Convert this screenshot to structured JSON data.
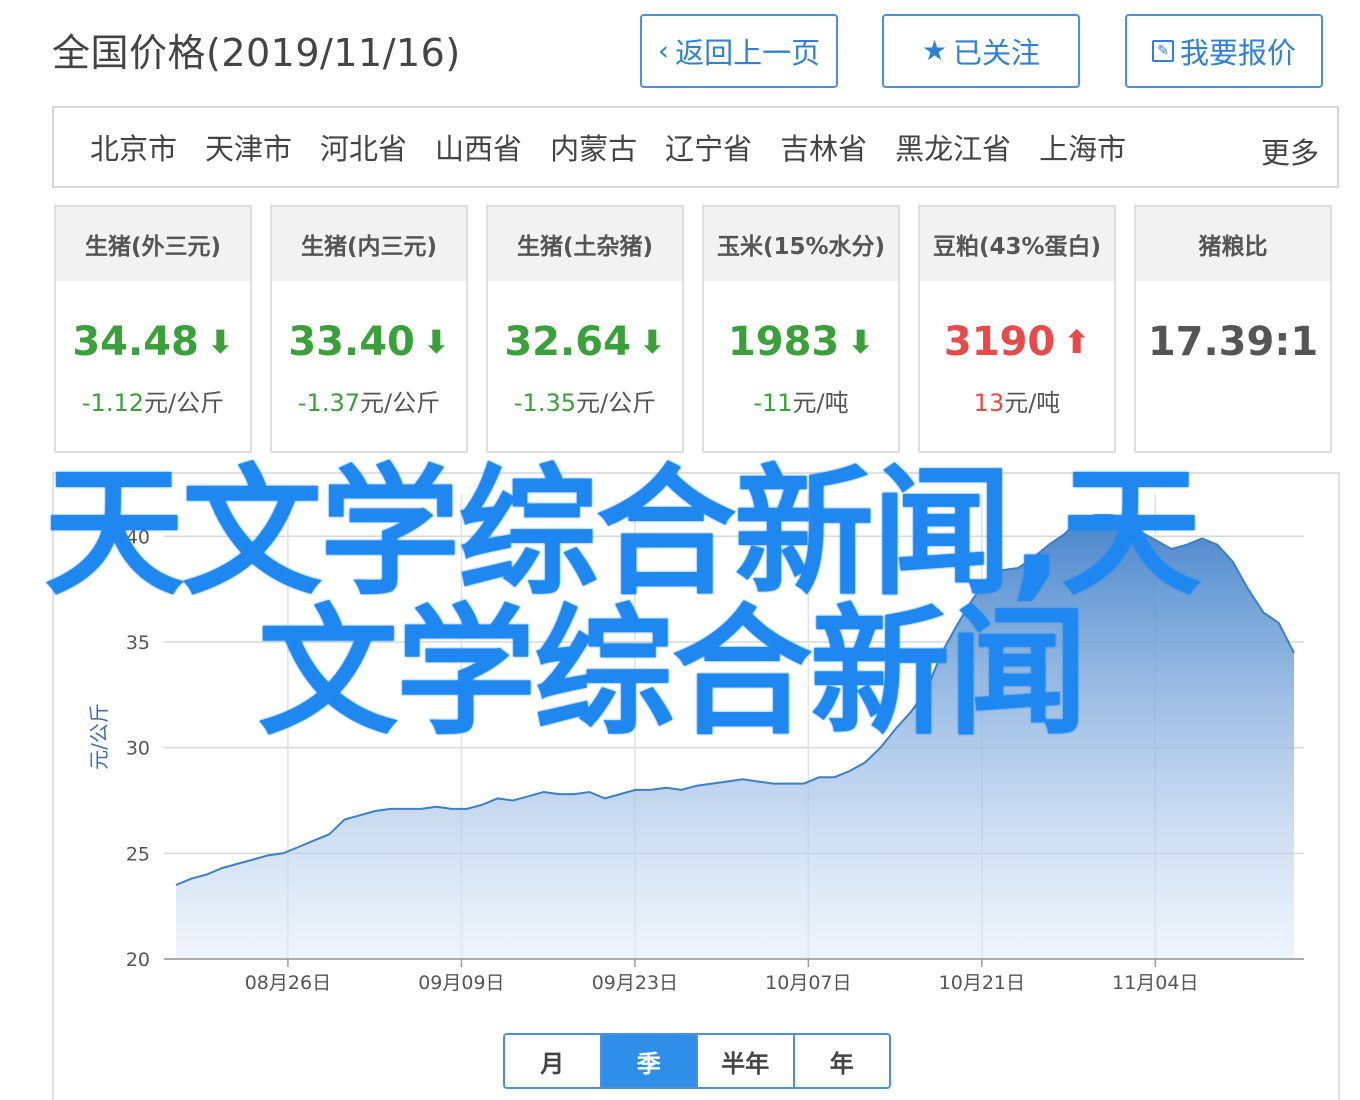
{
  "header": {
    "title": "全国价格(2019/11/16)",
    "back_label": "返回上一页",
    "follow_label": "已关注",
    "report_label": "我要报价"
  },
  "regions": {
    "items": [
      "北京市",
      "天津市",
      "河北省",
      "山西省",
      "内蒙古",
      "辽宁省",
      "吉林省",
      "黑龙江省",
      "上海市"
    ],
    "more_label": "更多"
  },
  "cards": [
    {
      "name": "生猪(外三元)",
      "price": "34.48",
      "trend": "down",
      "change": "-1.12",
      "unit": "元/公斤"
    },
    {
      "name": "生猪(内三元)",
      "price": "33.40",
      "trend": "down",
      "change": "-1.37",
      "unit": "元/公斤"
    },
    {
      "name": "生猪(土杂猪)",
      "price": "32.64",
      "trend": "down",
      "change": "-1.35",
      "unit": "元/公斤"
    },
    {
      "name": "玉米(15%水分)",
      "price": "1983",
      "trend": "down",
      "change": "-11",
      "unit": "元/吨"
    },
    {
      "name": "豆粕(43%蛋白)",
      "price": "3190",
      "trend": "up",
      "change": "13",
      "unit": "元/吨"
    },
    {
      "name": "猪粮比",
      "price": "17.39:1",
      "trend": "none",
      "change": "",
      "unit": ""
    }
  ],
  "colors": {
    "accent": "#2f8fe8",
    "down": "#3aa13a",
    "up": "#e84a4a",
    "line": "#3d7ec9",
    "overlay_text": "#1e88f0"
  },
  "icons": {
    "back": "chevron-left-icon",
    "follow": "star-icon",
    "report": "edit-icon",
    "down": "arrow-down-icon",
    "up": "arrow-up-icon"
  },
  "overlay": {
    "line1": "天文学综合新闻,天",
    "line2": "文学综合新闻"
  },
  "chart_data": {
    "type": "area",
    "ylabel": "元/公斤",
    "ylim": [
      20,
      42
    ],
    "yticks": [
      20,
      25,
      30,
      35,
      40
    ],
    "xtick_labels": [
      "08月26日",
      "09月09日",
      "09月23日",
      "10月07日",
      "10月21日",
      "11月04日"
    ],
    "x_start": "2019-08-16",
    "x_end": "2019-11-16",
    "grid": true,
    "series": [
      {
        "values": [
          23.5,
          23.8,
          24.0,
          24.3,
          24.5,
          24.7,
          24.9,
          25.0,
          25.3,
          25.6,
          25.9,
          26.6,
          26.8,
          27.0,
          27.1,
          27.1,
          27.1,
          27.2,
          27.1,
          27.1,
          27.3,
          27.6,
          27.5,
          27.7,
          27.9,
          27.8,
          27.8,
          27.9,
          27.6,
          27.8,
          28.0,
          28.0,
          28.1,
          28.0,
          28.2,
          28.3,
          28.4,
          28.5,
          28.4,
          28.3,
          28.3,
          28.3,
          28.6,
          28.6,
          28.9,
          29.3,
          30.0,
          30.9,
          31.7,
          32.7,
          34.5,
          35.8,
          37.0,
          38.0,
          38.4,
          38.5,
          39.0,
          39.6,
          40.1,
          40.8,
          41.0,
          41.0,
          40.9,
          40.2,
          39.8,
          39.4,
          39.6,
          39.9,
          39.6,
          38.8,
          37.5,
          36.4,
          35.9,
          34.48
        ]
      }
    ]
  }
}
